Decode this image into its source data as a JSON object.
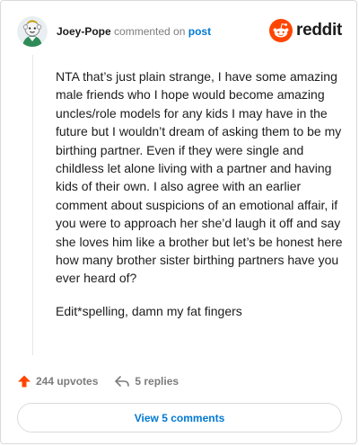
{
  "comment": {
    "author": "Joey-Pope",
    "action_text": "commented on",
    "post_link": "post",
    "paragraphs": [
      "NTA that’s just plain strange, I have some amazing male friends who I hope would become amazing uncles/role models for any kids I may have in the future but I wouldn’t dream of asking them to be my birthing partner. Even if they were single and childless let alone living with a partner and having kids of their own. I also agree with an earlier comment about suspicions of an emotional affair, if you were to approach her she’d laugh it off and say she loves him like a brother but let’s be honest here how many brother sister birthing partners have you ever heard of?",
      "Edit*spelling, damn my fat fingers"
    ]
  },
  "brand": {
    "name": "reddit",
    "icon": "reddit-logo-icon",
    "color": "#ff4500"
  },
  "footer": {
    "upvotes_label": "244 upvotes",
    "replies_label": "5 replies",
    "upvote_icon": "upvote-arrow-icon",
    "reply_icon": "reply-arrow-icon"
  },
  "view_comments_label": "View 5 comments",
  "colors": {
    "link": "#0079d3",
    "upvote": "#ff4500",
    "muted": "#7c7c7c",
    "border": "#dadada"
  }
}
